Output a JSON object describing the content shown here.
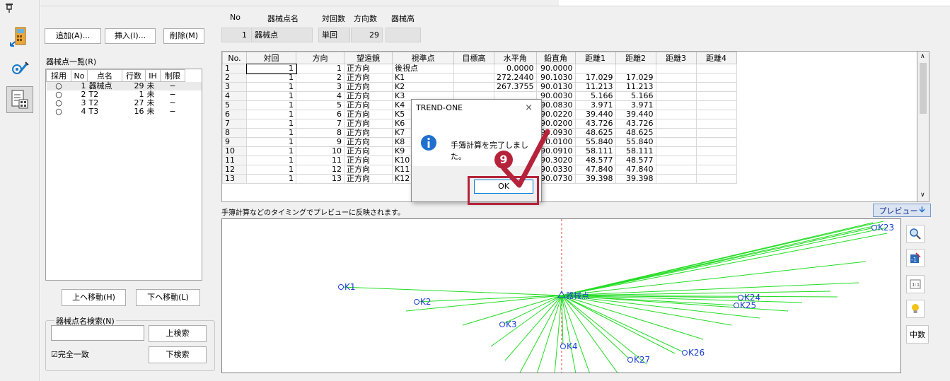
{
  "header": {
    "col_labels": [
      "No",
      "器械点名",
      "対回数",
      "方向数",
      "器械高"
    ],
    "no": "1",
    "name": "器械点",
    "taikai": "単回",
    "houkou_count": "29",
    "kikai_height": ""
  },
  "buttons": {
    "add": "追加(A)...",
    "insert": "挿入(I)...",
    "delete": "削除(M)",
    "move_up": "上へ移動(H)",
    "move_down": "下へ移動(L)",
    "search_up": "上検索",
    "search_down": "下検索"
  },
  "inst_list": {
    "title": "器械点一覧(R)",
    "columns": [
      "採用",
      "No",
      "点名",
      "行数",
      "IH",
      "制限"
    ],
    "rows": [
      {
        "use": "○",
        "no": "1",
        "name": "器械点",
        "lines": "29",
        "ih": "未",
        "limit": "−"
      },
      {
        "use": "○",
        "no": "2",
        "name": "T2",
        "lines": "1",
        "ih": "未",
        "limit": "−"
      },
      {
        "use": "○",
        "no": "3",
        "name": "T2",
        "lines": "27",
        "ih": "未",
        "limit": "−"
      },
      {
        "use": "○",
        "no": "4",
        "name": "T3",
        "lines": "16",
        "ih": "未",
        "limit": "−"
      }
    ]
  },
  "search": {
    "group_title": "器械点名検索(N)",
    "value": "",
    "exact_match": "☑完全一致"
  },
  "grid": {
    "columns": [
      "No.",
      "対回",
      "方向",
      "望遠鏡",
      "視準点",
      "目標高",
      "水平角",
      "鉛直角",
      "距離1",
      "距離2",
      "距離3",
      "距離4"
    ],
    "rows": [
      [
        "1",
        "1",
        "1",
        "正方向",
        "後視点",
        "",
        "0.0000",
        "90.0000",
        "",
        "",
        "",
        ""
      ],
      [
        "2",
        "1",
        "2",
        "正方向",
        "K1",
        "",
        "272.2440",
        "90.1030",
        "17.029",
        "17.029",
        "",
        ""
      ],
      [
        "3",
        "1",
        "3",
        "正方向",
        "K2",
        "",
        "267.3755",
        "90.0130",
        "11.213",
        "11.213",
        "",
        ""
      ],
      [
        "4",
        "1",
        "4",
        "正方向",
        "K3",
        "",
        "",
        "90.0030",
        "5.166",
        "5.166",
        "",
        ""
      ],
      [
        "5",
        "1",
        "5",
        "正方向",
        "K4",
        "",
        "",
        "90.0830",
        "3.971",
        "3.971",
        "",
        ""
      ],
      [
        "6",
        "1",
        "6",
        "正方向",
        "K5",
        "",
        "",
        "90.0220",
        "39.440",
        "39.440",
        "",
        ""
      ],
      [
        "7",
        "1",
        "7",
        "正方向",
        "K6",
        "",
        "",
        "90.0200",
        "43.726",
        "43.726",
        "",
        ""
      ],
      [
        "8",
        "1",
        "8",
        "正方向",
        "K7",
        "",
        "",
        "90.0930",
        "48.625",
        "48.625",
        "",
        ""
      ],
      [
        "9",
        "1",
        "9",
        "正方向",
        "K8",
        "",
        "",
        "90.0100",
        "55.840",
        "55.840",
        "",
        ""
      ],
      [
        "10",
        "1",
        "10",
        "正方向",
        "K9",
        "",
        "",
        "90.0910",
        "58.111",
        "58.111",
        "",
        ""
      ],
      [
        "11",
        "1",
        "11",
        "正方向",
        "K10",
        "",
        "",
        "90.3020",
        "48.577",
        "48.577",
        "",
        ""
      ],
      [
        "12",
        "1",
        "12",
        "正方向",
        "K11",
        "",
        "",
        "90.0330",
        "47.840",
        "47.840",
        "",
        ""
      ],
      [
        "13",
        "1",
        "13",
        "正方向",
        "K12",
        "",
        "",
        "90.0730",
        "39.398",
        "39.398",
        "",
        ""
      ]
    ]
  },
  "preview": {
    "message": "手簿計算などのタイミングでプレビューに反映されます。",
    "button": "プレビュー",
    "center_label": "器械点",
    "points": [
      "K1",
      "K2",
      "K3",
      "K4",
      "K23",
      "K24",
      "K25",
      "K26",
      "K27"
    ],
    "line_color": "#22dd22",
    "label_color": "#1a3fd0"
  },
  "right_tools": {
    "mid_label": "中数"
  },
  "dialog": {
    "title": "TREND-ONE",
    "message": "手簿計算を完了しました。",
    "ok": "OK",
    "close": "×"
  },
  "annotation": {
    "step": "9",
    "color": "#b5233a"
  }
}
